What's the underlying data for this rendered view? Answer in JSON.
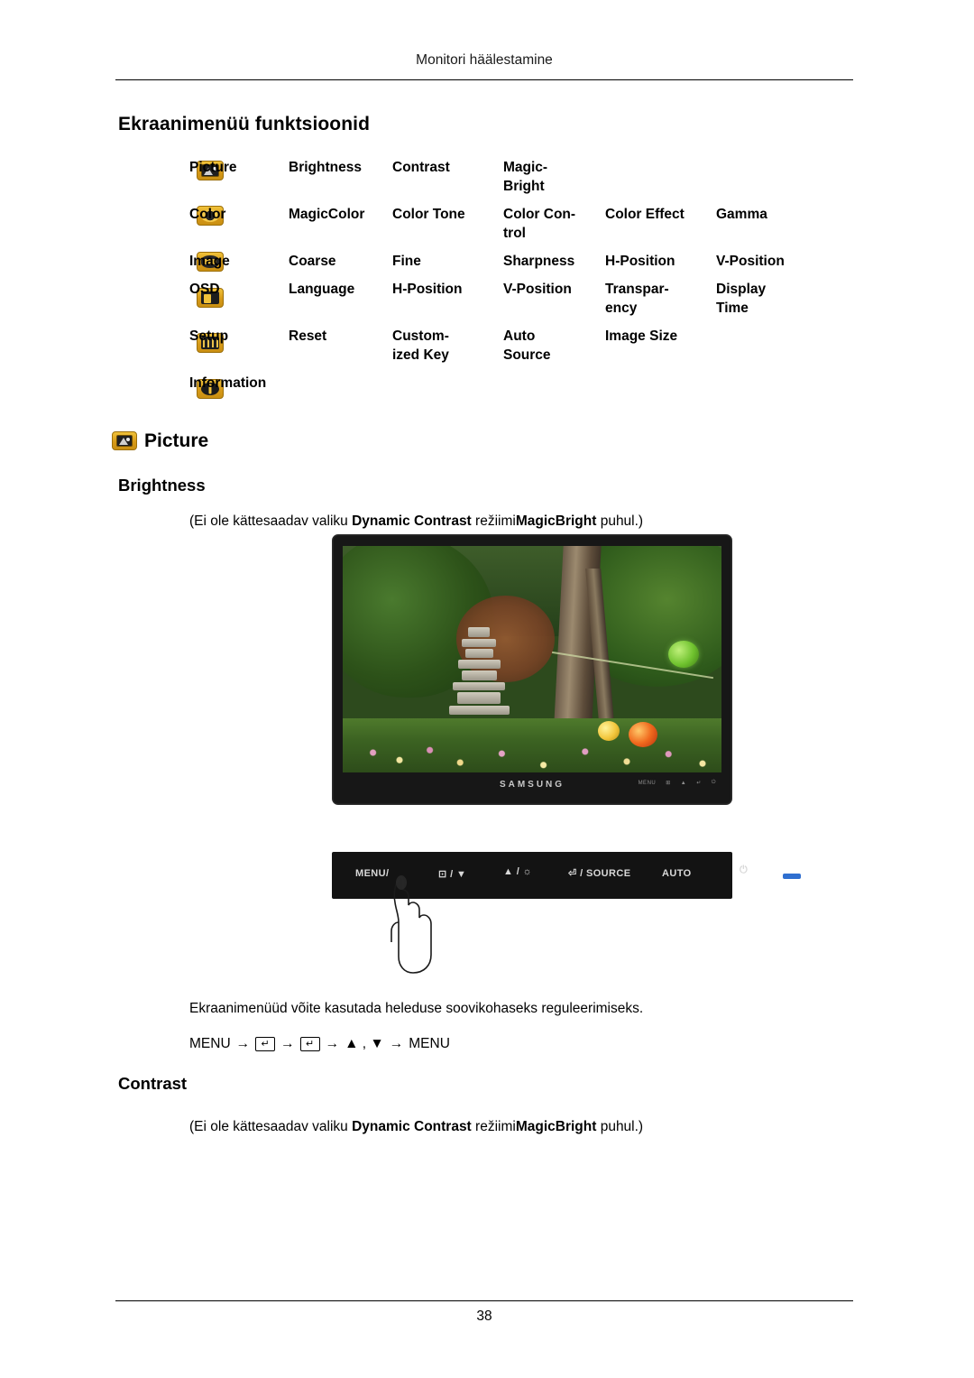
{
  "header": {
    "running_head": "Monitori häälestamine"
  },
  "footer": {
    "page_number": "38"
  },
  "section": {
    "title": "Ekraanimenüü funktsioonid"
  },
  "menu_table": {
    "rows": [
      {
        "icon": "picture-icon",
        "cells": [
          "Picture",
          "Brightness",
          "Contrast",
          "Magic-\nBright",
          "",
          ""
        ]
      },
      {
        "icon": "color-icon",
        "cells": [
          "Color",
          "MagicColor",
          "Color Tone",
          "Color  Con-\ntrol",
          "Color Effect",
          "Gamma"
        ]
      },
      {
        "icon": "image-icon",
        "cells": [
          "Image",
          "Coarse",
          "Fine",
          "Sharpness",
          "H-Position",
          "V-Position"
        ]
      },
      {
        "icon": "osd-icon",
        "cells": [
          "OSD",
          "Language",
          "H-Position",
          "V-Position",
          "Transpar-\nency",
          "Display\nTime"
        ]
      },
      {
        "icon": "setup-icon",
        "cells": [
          "Setup",
          "Reset",
          "Custom-\nized Key",
          "Auto\nSource",
          "Image Size",
          ""
        ]
      },
      {
        "icon": "information-icon",
        "cells": [
          "Information",
          "",
          "",
          "",
          "",
          ""
        ]
      }
    ],
    "row1": {
      "c0": "Picture",
      "c1": "Brightness",
      "c2": "Contrast",
      "c3a": "Magic-",
      "c3b": "Bright"
    },
    "row2": {
      "c0": "Color",
      "c1": "MagicColor",
      "c2": "Color Tone",
      "c3a": "Color   Con-",
      "c3b": "trol",
      "c4": "Color Effect",
      "c5": "Gamma"
    },
    "row3": {
      "c0": "Image",
      "c1": "Coarse",
      "c2": "Fine",
      "c3": "Sharpness",
      "c4": "H-Position",
      "c5": "V-Position"
    },
    "row4": {
      "c0": "OSD",
      "c1": "Language",
      "c2": "H-Position",
      "c3": "V-Position",
      "c4a": "Transpar-",
      "c4b": "ency",
      "c5a": "Display",
      "c5b": "Time"
    },
    "row5": {
      "c0": "Setup",
      "c1": "Reset",
      "c2a": "Custom-",
      "c2b": "ized Key",
      "c3a": "Auto",
      "c3b": "Source",
      "c4": "Image Size"
    },
    "row6": {
      "c0": "Information"
    }
  },
  "picture_section": {
    "title": "Picture",
    "brightness_heading": "Brightness",
    "contrast_heading": "Contrast",
    "note_prefix": "(Ei ole kättesaadav valiku ",
    "note_bold1": "Dynamic Contrast",
    "note_mid": " režiimi",
    "note_bold2": "MagicBright",
    "note_suffix": " puhul.)",
    "body_text": "Ekraanimenüüd võite kasutada heleduse soovikohaseks reguleerimiseks.",
    "menu_path": {
      "start": "MENU",
      "arrow": "→",
      "key1": "↵",
      "key2": "↵",
      "updown": "▲ , ▼",
      "end": "MENU"
    }
  },
  "monitor": {
    "brand": "SAMSUNG",
    "bezel_buttons": [
      "MENU",
      "⊞",
      "▲",
      "↵",
      "⏻"
    ]
  },
  "control_panel": {
    "buttons": [
      {
        "label": "MENU/ ",
        "name": "menu-button"
      },
      {
        "label": "⊡ / ▼",
        "name": "brightness-down-button"
      },
      {
        "label": "▲ / ☼",
        "name": "brightness-up-button"
      },
      {
        "label": "⏎ / SOURCE",
        "name": "source-button"
      },
      {
        "label": "AUTO",
        "name": "auto-button"
      },
      {
        "label": "⏻",
        "name": "power-button"
      }
    ],
    "led_color": "#2f6fd0"
  }
}
